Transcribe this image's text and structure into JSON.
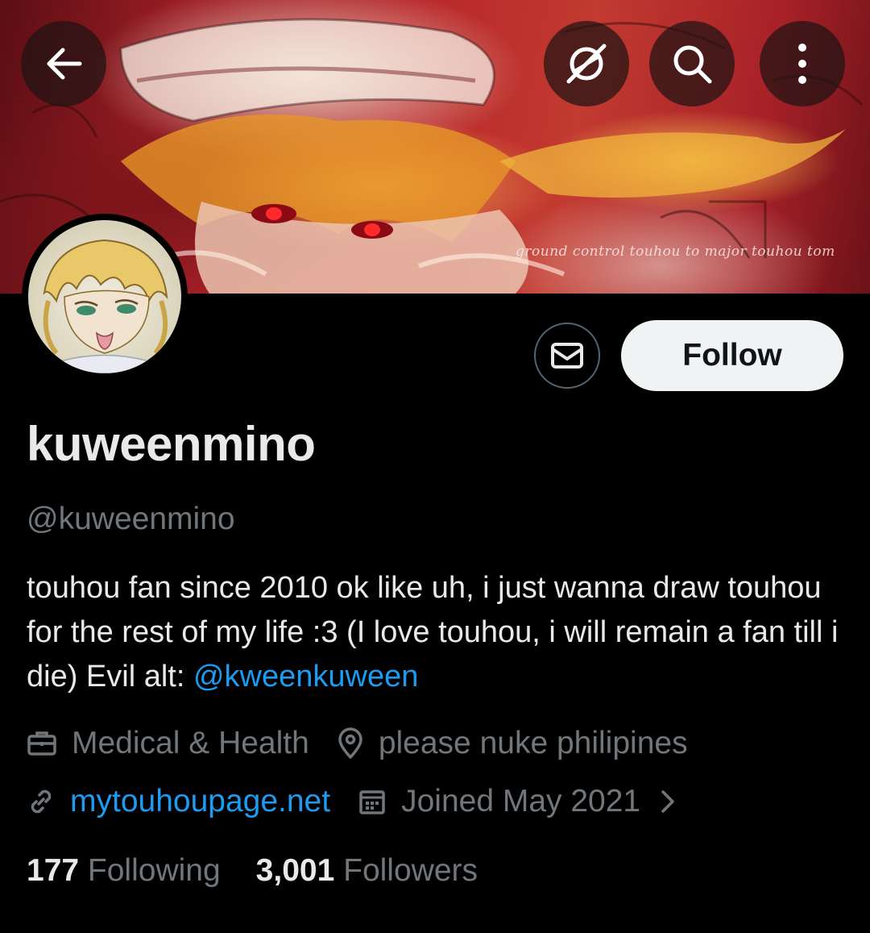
{
  "banner": {
    "caption": "ground control touhou to major touhou tom"
  },
  "top_bar": {
    "icons": [
      "arrow-left-icon",
      "grok-icon",
      "search-icon",
      "more-vertical-icon"
    ]
  },
  "actions": {
    "message_icon": "envelope-icon",
    "follow_label": "Follow"
  },
  "profile": {
    "display_name": "kuweenmino",
    "handle": "@kuweenmino",
    "bio_text": "touhou fan since 2010 ok like uh, i just wanna draw touhou for the rest of my life :3 (I love touhou, i will remain a fan till i die) Evil alt: ",
    "bio_mention": "@kweenkuween",
    "category": "Medical & Health",
    "location": "please nuke philipines",
    "website": "mytouhoupage.net",
    "joined": "Joined May 2021"
  },
  "stats": {
    "following_count": "177",
    "following_label": "Following",
    "followers_count": "3,001",
    "followers_label": "Followers"
  },
  "colors": {
    "background": "#000000",
    "text_primary": "#e7e9ea",
    "text_secondary": "#71767b",
    "link": "#1d9bf0",
    "follow_bg": "#eff3f4"
  }
}
